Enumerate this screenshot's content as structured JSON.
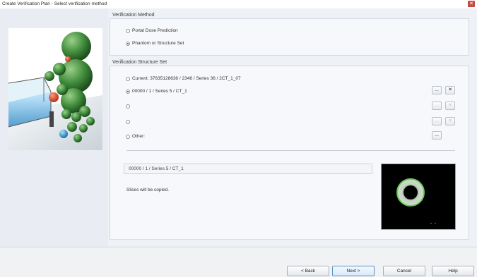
{
  "window": {
    "title": "Create Verification Plan  -  Select verification method",
    "close_glyph": "✕"
  },
  "verification_method": {
    "title": "Verification Method",
    "options": [
      {
        "label": "Portal Dose Prediction",
        "selected": false
      },
      {
        "label": "Phantom or Structure Set",
        "selected": true
      }
    ]
  },
  "structure_set": {
    "title": "Verification Structure Set",
    "options": [
      {
        "label": "Current: 37635128636 / 2346 / Series 36 / 2CT_1_07",
        "selected": false
      },
      {
        "label": "00000 / 1 / Series 5 / CT_1",
        "selected": true
      },
      {
        "label": "",
        "selected": false
      },
      {
        "label": "",
        "selected": false
      },
      {
        "label": "Other:",
        "selected": false
      }
    ],
    "browse_glyph": "...",
    "clear_glyph": "✕",
    "selected_value": "00000 / 1 / Series 5 / CT_1",
    "note": "Slices will be copied."
  },
  "footer": {
    "back": "< Back",
    "next": "Next >",
    "cancel": "Cancel",
    "help": "Help"
  },
  "colors": {
    "accent": "#5a8fc6",
    "close": "#c8493f",
    "panel": "#eef1f6"
  }
}
